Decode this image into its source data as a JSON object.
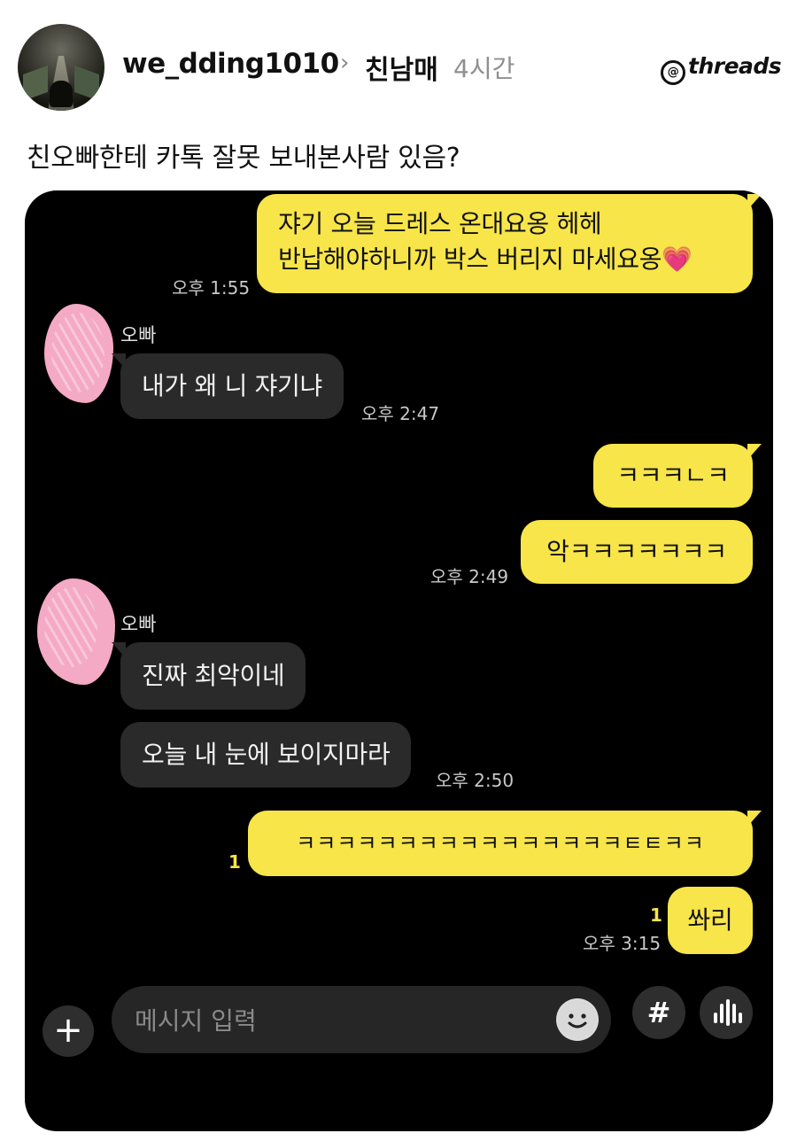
{
  "post": {
    "username": "we_dding1010",
    "chevron": "›",
    "topic": "친남매",
    "time_ago": "4시간",
    "brand": "threads",
    "brand_symbol": "@",
    "text": "친오빠한테 카톡 잘못 보내본사람 있음?"
  },
  "chat": {
    "messages": [
      {
        "line1": "쟈기 오늘 드레스 온대요옹 헤헤",
        "line2": "반납해야하니까 박스 버리지 마세요옹",
        "emoji": "💗",
        "time": "오후 1:55"
      },
      {
        "sender": "오빠",
        "text": "내가 왜 니 쟈기냐",
        "time": "오후 2:47"
      },
      {
        "text": "ㅋㅋㅋㄴㅋ"
      },
      {
        "text": "악ㅋㅋㅋㅋㅋㅋㅋ",
        "time": "오후 2:49"
      },
      {
        "sender": "오빠",
        "text": "진짜 최악이네"
      },
      {
        "text": "오늘 내 눈에 보이지마라",
        "time": "오후 2:50"
      },
      {
        "text": "ㅋㅋㅋㅋㅋㅋㅋㅋㅋㅋㅋㅋㅋㅋㅋㅋㅌㅌㅋㅋ",
        "unread": "1"
      },
      {
        "text": "쏴리",
        "unread": "1",
        "time": "오후 3:15"
      }
    ],
    "input": {
      "placeholder": "메시지 입력",
      "plus": "+",
      "hash": "#"
    }
  }
}
